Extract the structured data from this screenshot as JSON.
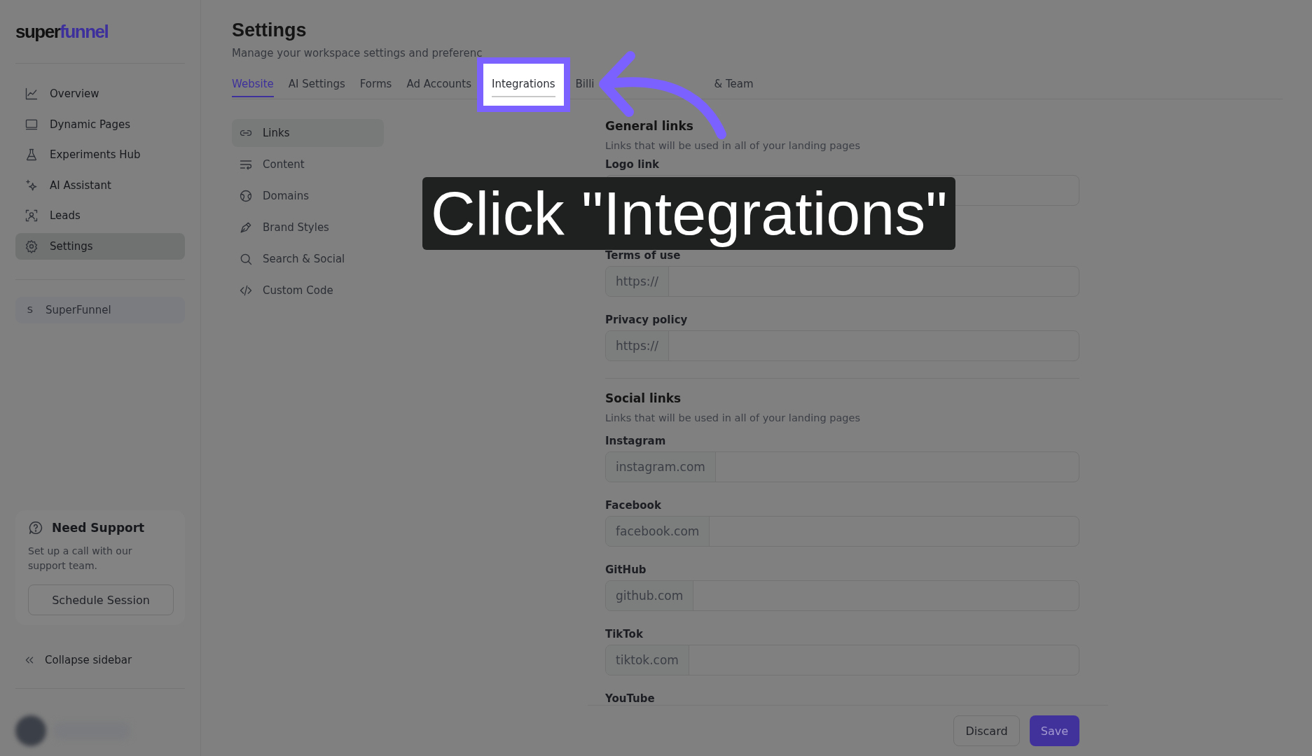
{
  "logo": {
    "dark": "super",
    "accent": "funnel"
  },
  "nav": [
    {
      "label": "Overview",
      "selected": false
    },
    {
      "label": "Dynamic Pages",
      "selected": false
    },
    {
      "label": "Experiments Hub",
      "selected": false
    },
    {
      "label": "AI Assistant",
      "selected": false
    },
    {
      "label": "Leads",
      "selected": false
    },
    {
      "label": "Settings",
      "selected": true
    }
  ],
  "workspace": {
    "initial": "S",
    "name": "SuperFunnel"
  },
  "support": {
    "title": "Need Support",
    "text": "Set up a call with our support team.",
    "button": "Schedule Session"
  },
  "collapse": "Collapse sidebar",
  "header": {
    "title": "Settings",
    "subtitle": "Manage your workspace settings and preferenc"
  },
  "tabs": [
    {
      "label": "Website",
      "selected": true,
      "highlighted": false
    },
    {
      "label": "AI Settings",
      "selected": false,
      "highlighted": false
    },
    {
      "label": "Forms",
      "selected": false,
      "highlighted": false
    },
    {
      "label": "Ad Accounts",
      "selected": false,
      "highlighted": false
    },
    {
      "label": "Integrations",
      "selected": false,
      "highlighted": true
    },
    {
      "label": "Billi",
      "selected": false,
      "highlighted": false
    },
    {
      "label": "& Team",
      "selected": false,
      "highlighted": false
    }
  ],
  "subnav": [
    {
      "label": "Links",
      "selected": true
    },
    {
      "label": "Content",
      "selected": false
    },
    {
      "label": "Domains",
      "selected": false
    },
    {
      "label": "Brand Styles",
      "selected": false
    },
    {
      "label": "Search & Social",
      "selected": false
    },
    {
      "label": "Custom Code",
      "selected": false
    }
  ],
  "sections": [
    {
      "title": "General links",
      "description": "Links that will be used in all of your landing pages",
      "fields": [
        {
          "label": "Logo link"
        },
        {
          "label": "Terms of use",
          "prefix": "https://"
        },
        {
          "label": "Privacy policy",
          "prefix": "https://"
        }
      ]
    },
    {
      "title": "Social links",
      "description": "Links that will be used in all of your landing pages",
      "fields": [
        {
          "label": "Instagram",
          "prefix": "instagram.com"
        },
        {
          "label": "Facebook",
          "prefix": "facebook.com"
        },
        {
          "label": "GitHub",
          "prefix": "github.com"
        },
        {
          "label": "TikTok",
          "prefix": "tiktok.com"
        },
        {
          "label": "YouTube"
        }
      ]
    }
  ],
  "footer": {
    "discard": "Discard",
    "save": "Save"
  },
  "caption": "Click \"Integrations\""
}
